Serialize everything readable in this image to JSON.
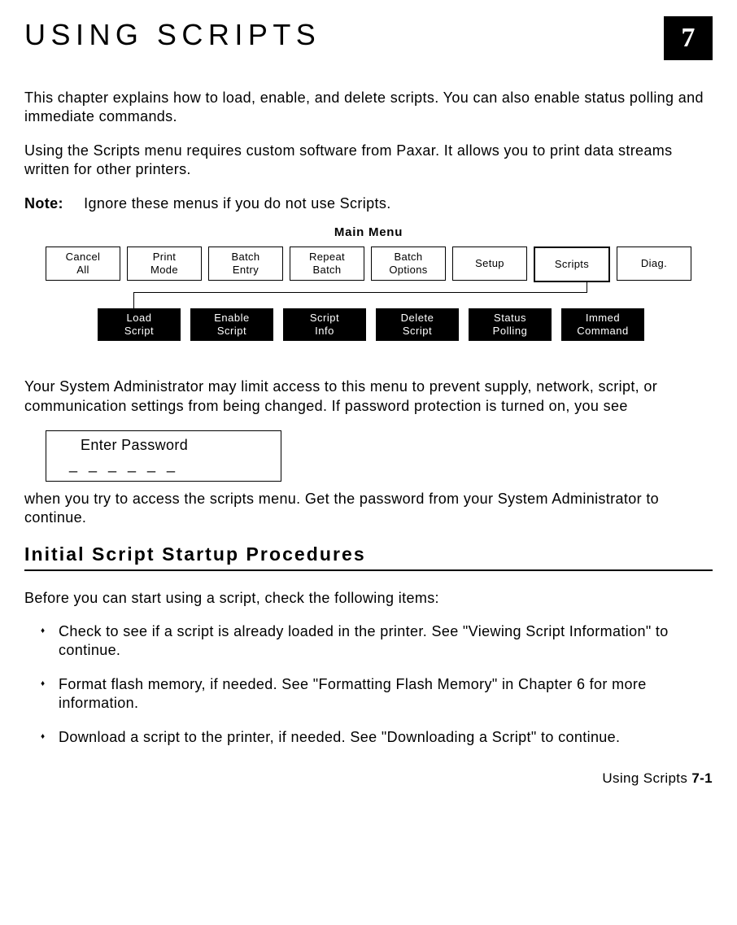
{
  "header": {
    "title": "USING SCRIPTS",
    "chapter_number": "7"
  },
  "paragraphs": {
    "p1": "This chapter explains how to load, enable, and delete scripts.  You can also enable status polling and immediate commands.",
    "p2": "Using the Scripts menu requires custom software from Paxar.  It allows you to print data streams written for other printers.",
    "note_label": "Note:",
    "note_text": "Ignore these menus if you do not use Scripts.",
    "p3": "Your System Administrator may limit access to this menu to prevent supply, network, script, or communication settings from being changed.  If password protection is turned on, you see",
    "p4": "when you try to access the scripts menu.  Get the password from your System Administrator to continue."
  },
  "diagram": {
    "title": "Main Menu",
    "top": [
      "Cancel\nAll",
      "Print\nMode",
      "Batch\nEntry",
      "Repeat\nBatch",
      "Batch\nOptions",
      "Setup",
      "Scripts",
      "Diag."
    ],
    "bottom": [
      "Load\nScript",
      "Enable\nScript",
      "Script\nInfo",
      "Delete\nScript",
      "Status\nPolling",
      "Immed\nCommand"
    ]
  },
  "password_box": {
    "line1": "Enter Password",
    "line2": "_ _ _ _ _ _"
  },
  "section_heading": "Initial Script Startup Procedures",
  "intro2": "Before you can start using a script, check the following items:",
  "bullets": [
    "Check to see if a script is already loaded in the printer.  See \"Viewing Script Information\" to continue.",
    "Format flash memory, if needed.  See \"Formatting Flash Memory\" in Chapter 6 for more information.",
    "Download a script to the printer, if needed.  See \"Downloading a Script\" to continue."
  ],
  "footer": {
    "text": "Using Scripts",
    "page": "7-1"
  }
}
